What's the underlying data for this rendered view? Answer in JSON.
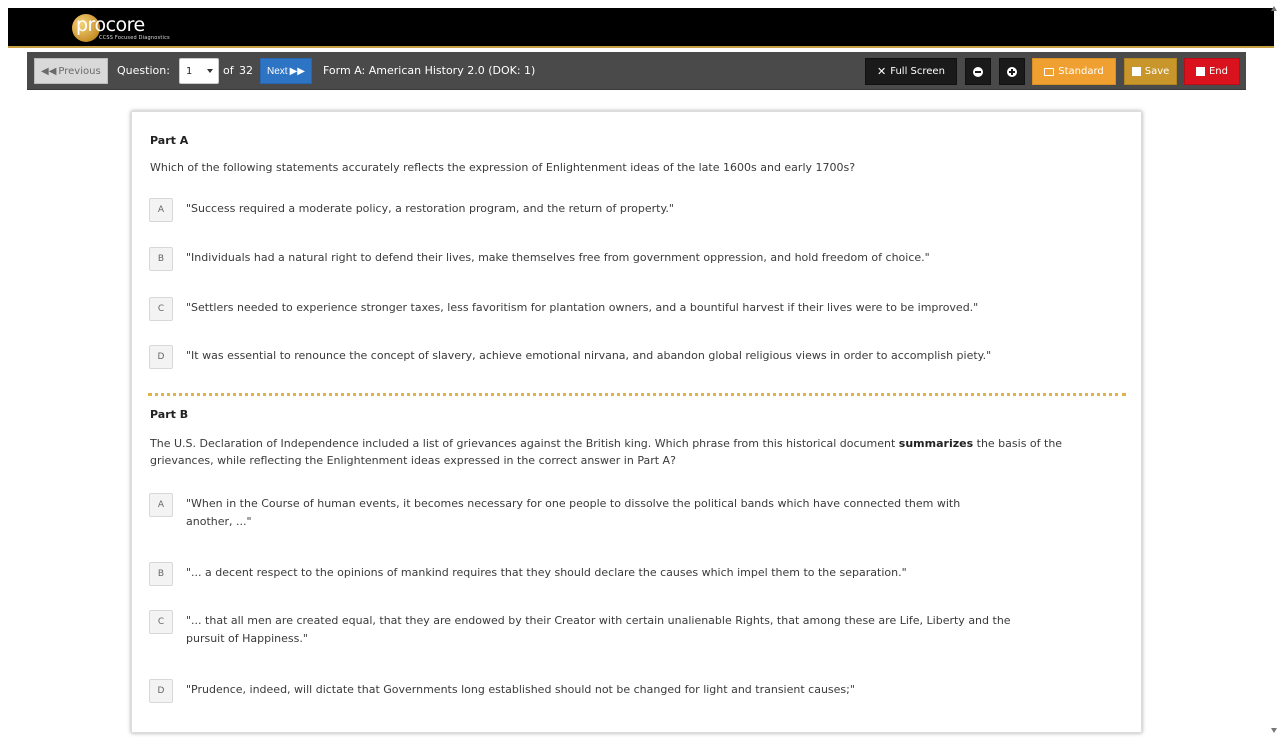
{
  "header": {
    "logo_word1": "pro",
    "logo_word2": "core",
    "logo_subtitle": "CCSS Focused Diagnostics",
    "bg_color": "#000000",
    "accent_color": "#c8a042"
  },
  "toolbar": {
    "prev_label": "Previous",
    "question_label": "Question:",
    "question_value": "1",
    "of_label": "of",
    "total_questions": "32",
    "next_label": "Next",
    "form_title": "Form A: American History 2.0 (DOK: 1)",
    "fullscreen_label": "Full Screen",
    "standard_label": "Standard",
    "save_label": "Save",
    "end_label": "End",
    "colors": {
      "toolbar_bg": "#4a4a4a",
      "next": "#2e74c4",
      "standard": "#f0a030",
      "save": "#c8962a",
      "end": "#d9121d"
    }
  },
  "part_a": {
    "title": "Part A",
    "prompt": "Which of the following statements accurately reflects the expression of Enlightenment ideas of the late 1600s and early 1700s?",
    "options": [
      {
        "letter": "A",
        "text": "\"Success required a moderate policy, a restoration program, and the return of property.\""
      },
      {
        "letter": "B",
        "text": "\"Individuals had a natural right to defend their lives, make themselves free from government oppression, and hold freedom of choice.\""
      },
      {
        "letter": "C",
        "text": "\"Settlers needed to experience stronger taxes, less favoritism for plantation owners, and a bountiful harvest if their lives were to be improved.\""
      },
      {
        "letter": "D",
        "text": "\"It was essential to renounce the concept of slavery, achieve emotional nirvana, and abandon global religious views in order to accomplish piety.\""
      }
    ]
  },
  "part_b": {
    "title": "Part B",
    "prompt_before": "The U.S. Declaration of Independence included a list of grievances against the British king. Which phrase from this historical document ",
    "prompt_bold": "summarizes",
    "prompt_after": " the basis of the grievances, while reflecting the Enlightenment ideas expressed in the correct answer in Part A?",
    "options": [
      {
        "letter": "A",
        "text": "\"When in the Course of human events, it becomes necessary for one people to dissolve the political bands which have connected them with another, ...\""
      },
      {
        "letter": "B",
        "text": "\"... a decent respect to the opinions of mankind requires that they should declare the causes which impel them to the separation.\""
      },
      {
        "letter": "C",
        "text": "\"... that all men are created equal, that they are endowed by their Creator with certain unalienable Rights, that among these are Life, Liberty and the pursuit of Happiness.\""
      },
      {
        "letter": "D",
        "text": "\"Prudence, indeed, will dictate that Governments long established should not be changed for light and transient causes;\""
      }
    ]
  }
}
